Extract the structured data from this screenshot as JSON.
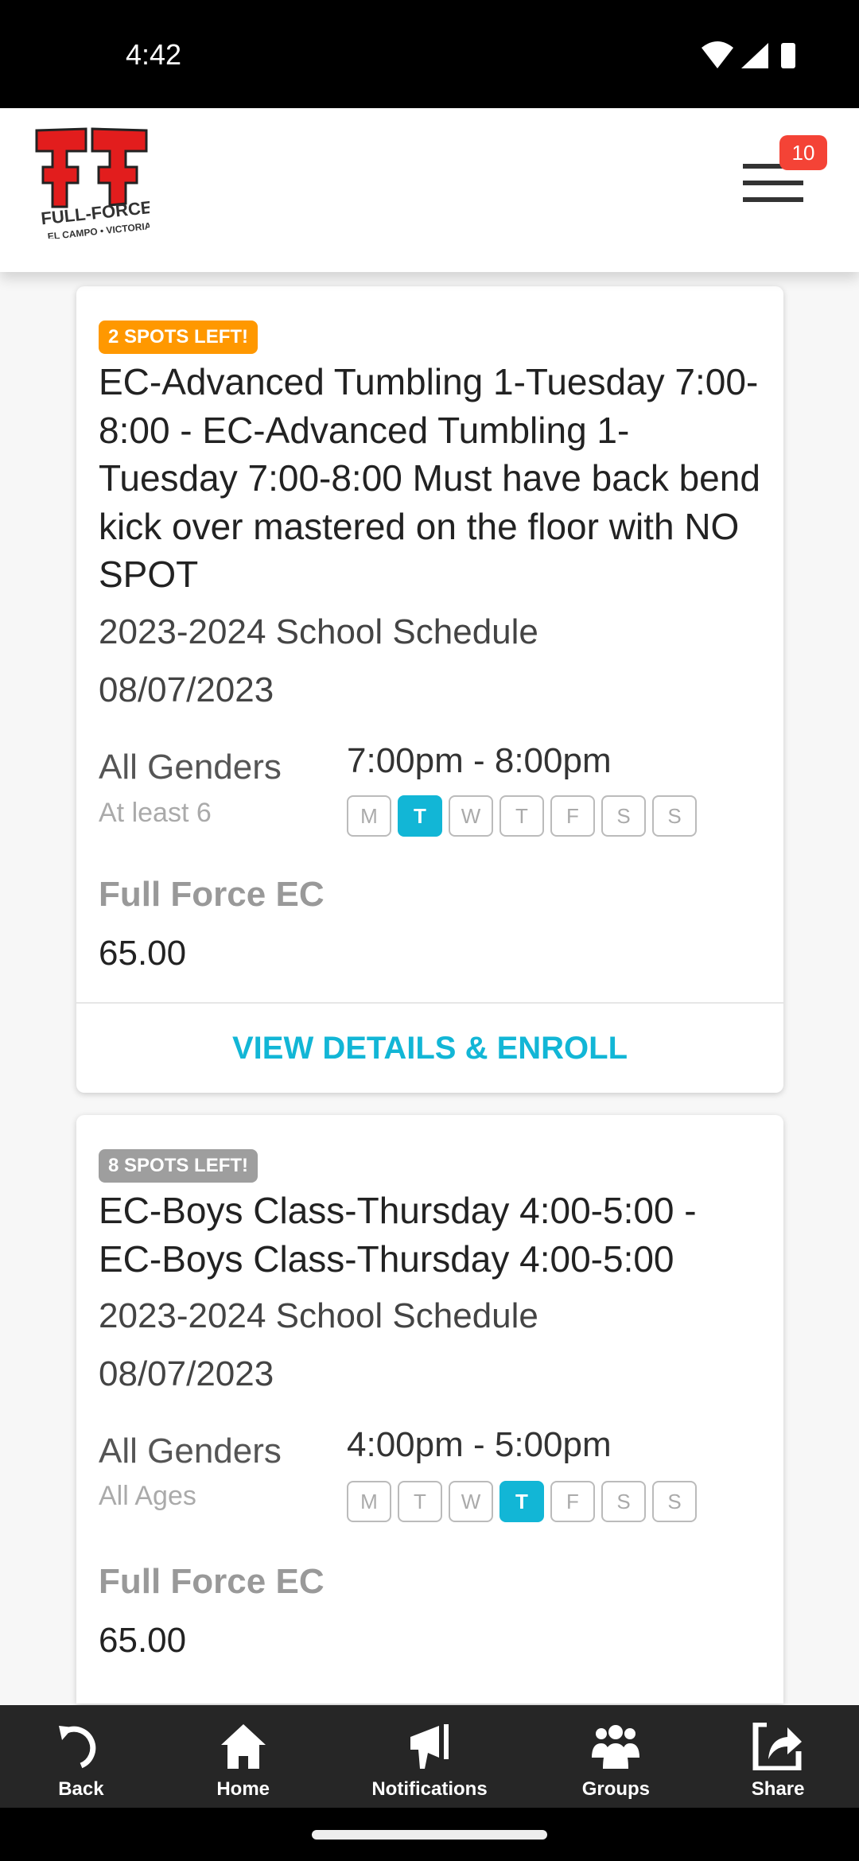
{
  "status_bar": {
    "time": "4:42"
  },
  "header": {
    "logo_text": "FULL-FORCE EL CAMPO • VICTORIA",
    "notification_count": "10"
  },
  "classes": [
    {
      "badge": "2 SPOTS LEFT!",
      "badge_color": "#ff9800",
      "title": "EC-Advanced Tumbling 1-Tuesday 7:00-8:00 - EC-Advanced Tumbling 1-Tuesday 7:00-8:00 Must have back bend kick over mastered on the floor with NO SPOT",
      "schedule": "2023-2024 School Schedule",
      "date": "08/07/2023",
      "gender": "All Genders",
      "age": "At least 6",
      "time": "7:00pm - 8:00pm",
      "days": [
        "M",
        "T",
        "W",
        "T",
        "F",
        "S",
        "S"
      ],
      "active_day": 1,
      "location": "Full Force EC",
      "price": "65.00",
      "action": "VIEW DETAILS & ENROLL"
    },
    {
      "badge": "8 SPOTS LEFT!",
      "badge_color": "#9e9e9e",
      "title": "EC-Boys Class-Thursday 4:00-5:00 - EC-Boys Class-Thursday 4:00-5:00",
      "schedule": "2023-2024 School Schedule",
      "date": "08/07/2023",
      "gender": "All Genders",
      "age": "All Ages",
      "time": "4:00pm - 5:00pm",
      "days": [
        "M",
        "T",
        "W",
        "T",
        "F",
        "S",
        "S"
      ],
      "active_day": 3,
      "location": "Full Force EC",
      "price": "65.00"
    }
  ],
  "bottom_nav": [
    {
      "label": "Back",
      "icon": "undo-icon"
    },
    {
      "label": "Home",
      "icon": "home-icon"
    },
    {
      "label": "Notifications",
      "icon": "megaphone-icon"
    },
    {
      "label": "Groups",
      "icon": "group-icon"
    },
    {
      "label": "Share",
      "icon": "share-icon"
    }
  ],
  "accent": "#12b6d6"
}
